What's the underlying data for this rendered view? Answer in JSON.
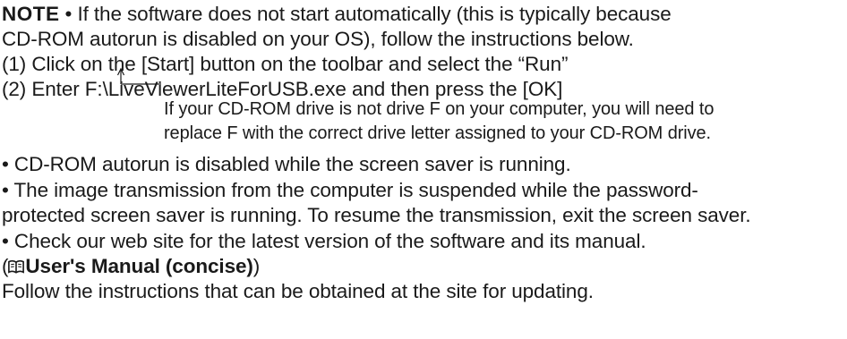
{
  "note": {
    "label": "NOTE",
    "line1": "• If the software does not start automatically (this is typically because",
    "line2": "CD-ROM autorun is disabled on your OS), follow the instructions below.",
    "step1": "(1) Click on the [Start] button on the toolbar and select the “Run”",
    "step2": "(2) Enter F:\\LiveViewerLiteForUSB.exe and then press the [OK]",
    "callout_line1": "If your CD-ROM drive is not drive F on your computer, you will need to",
    "callout_line2": "replace F with the correct drive letter assigned to your CD-ROM drive.",
    "bullet_autorun": "• CD-ROM autorun is disabled while the screen saver is running.",
    "bullet_transmission_1": "• The image transmission from the computer is suspended while the password-",
    "bullet_transmission_2": "protected screen saver is running. To resume the transmission, exit the screen saver.",
    "bullet_website": "• Check our web site for the latest version of the software and its manual.",
    "manual_open": "(",
    "manual_label": "User's Manual (concise)",
    "manual_close": ")",
    "follow_line": " Follow the instructions that can be obtained at the site for updating."
  },
  "icons": {
    "manual": "book-icon"
  }
}
